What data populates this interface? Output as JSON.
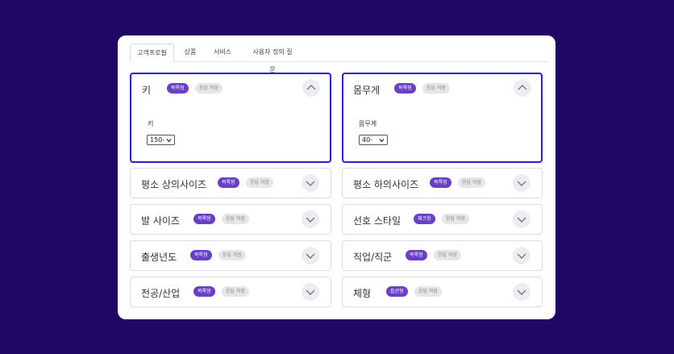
{
  "tabs": [
    "고객프로필",
    "상품",
    "서비스",
    "사용자 정의 질문"
  ],
  "cards": {
    "height": {
      "title": "키",
      "type_badge": "목록형",
      "save_badge": "응답 저장",
      "field_label": "키",
      "select_value": "150-"
    },
    "weight": {
      "title": "몸무게",
      "type_badge": "목록형",
      "save_badge": "응답 저장",
      "field_label": "몸무게",
      "select_value": "40-"
    },
    "top_size": {
      "title": "평소 상의사이즈",
      "type_badge": "목록형",
      "save_badge": "응답 저장"
    },
    "bottom_size": {
      "title": "평소 하의사이즈",
      "type_badge": "목록형",
      "save_badge": "응답 저장"
    },
    "foot_size": {
      "title": "발 사이즈",
      "type_badge": "목록형",
      "save_badge": "응답 저장"
    },
    "style": {
      "title": "선호 스타일",
      "type_badge": "체크형",
      "save_badge": "응답 저장"
    },
    "birth_year": {
      "title": "출생년도",
      "type_badge": "목록형",
      "save_badge": "응답 저장"
    },
    "job": {
      "title": "직업/직군",
      "type_badge": "목록형",
      "save_badge": "응답 저장"
    },
    "major": {
      "title": "전공/산업",
      "type_badge": "목록형",
      "save_badge": "응답 저장"
    },
    "body_type": {
      "title": "체형",
      "type_badge": "옵션형",
      "save_badge": "응답 저장"
    }
  },
  "colors": {
    "background": "#1f0763",
    "accent_border": "#2b20c9",
    "type_badge": "#6a3fc8"
  }
}
